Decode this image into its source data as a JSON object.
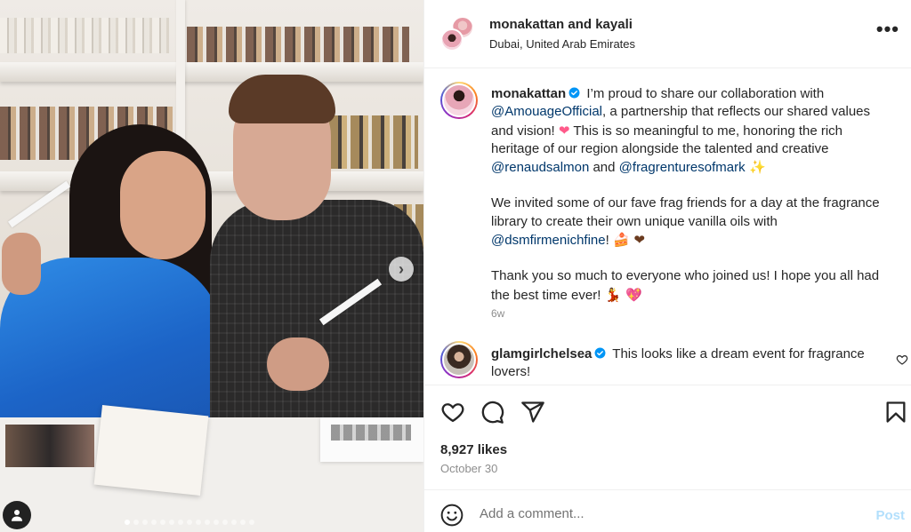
{
  "header": {
    "user1": "monakattan",
    "joiner": " and ",
    "user2": "kayali",
    "location": "Dubai, United Arab Emirates",
    "more_label": "•••"
  },
  "caption": {
    "username": "monakattan",
    "line1_text": " I’m proud to share our collaboration with ",
    "mention1": "@AmouageOfficial",
    "line2_text": ", a partnership that reflects our shared values and vision! ",
    "emoji_heart": "❤",
    "line3_text": " This is so meaningful to me, honoring the rich heritage of our region alongside the talented and creative ",
    "mention2": "@renaudsalmon",
    "and_text": " and ",
    "mention3": "@fragrenturesofmark",
    "emoji_sparkles": " ✨",
    "para2_text": "We invited some of our fave frag friends for a day at the fragrance library to create their own unique vanilla oils with ",
    "mention4": "@dsmfirmenichfine",
    "para2_end": "! ",
    "emoji_cake": "🍰",
    "emoji_brown_heart": " ❤",
    "para3_text": "Thank you so much to everyone who joined us! I hope you all had the best time ever! ",
    "emoji_dancer": "💃",
    "emoji_sparkle_heart": " 💖",
    "time_ago": "6w"
  },
  "comment2": {
    "username": "glamgirlchelsea",
    "text": " This looks like a dream event for fragrance lovers!"
  },
  "engagement": {
    "likes": "8,927 likes",
    "date": "October 30"
  },
  "add_comment": {
    "placeholder": "Add a comment...",
    "post_label": "Post"
  },
  "carousel": {
    "next_label": "›",
    "slide_count": 15,
    "active_slide": 1
  },
  "colors": {
    "mention": "#00376b",
    "post_disabled": "#b2dffc",
    "verified": "#0095f6",
    "secondary_text": "#8e8e8e"
  }
}
